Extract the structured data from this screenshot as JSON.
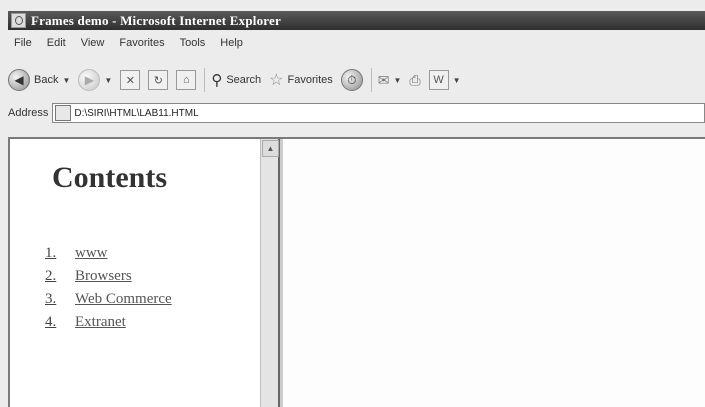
{
  "window": {
    "title": "Frames demo - Microsoft Internet Explorer"
  },
  "menu": [
    "File",
    "Edit",
    "View",
    "Favorites",
    "Tools",
    "Help"
  ],
  "toolbar": {
    "back_label": "Back",
    "search_label": "Search",
    "favorites_label": "Favorites"
  },
  "address": {
    "label": "Address",
    "value": "D:\\SIRI\\HTML\\LAB11.HTML"
  },
  "left_frame": {
    "heading": "Contents",
    "items": [
      {
        "num": "1.",
        "label": "www"
      },
      {
        "num": "2.",
        "label": "Browsers"
      },
      {
        "num": "3.",
        "label": "Web Commerce"
      },
      {
        "num": "4.",
        "label": "Extranet"
      }
    ]
  }
}
